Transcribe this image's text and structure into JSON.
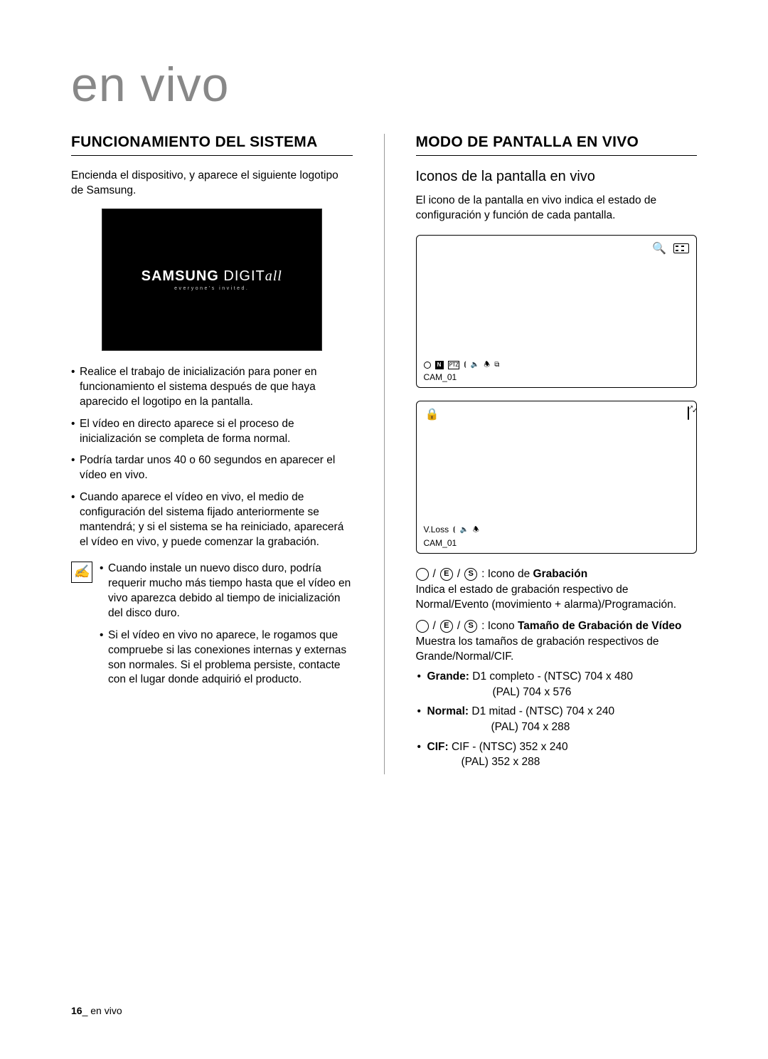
{
  "page_title": "en vivo",
  "left": {
    "heading": "FUNCIONAMIENTO DEL SISTEMA",
    "intro": "Encienda el dispositivo, y aparece el siguiente logotipo de Samsung.",
    "splash_brand_1": "SAMSUNG",
    "splash_brand_2": " DIGIT",
    "splash_brand_3": "all",
    "splash_tagline": "everyone's invited.",
    "bullets": [
      "Realice el trabajo de inicialización para poner en funcionamiento el sistema después de que haya aparecido el logotipo en la pantalla.",
      "El vídeo en directo aparece si el proceso de inicialización se completa de forma normal.",
      "Podría tardar unos 40 o 60 segundos en aparecer el vídeo en vivo.",
      "Cuando aparece el vídeo en vivo, el medio de configuración del sistema fijado anteriormente se mantendrá; y si el sistema se ha reiniciado, aparecerá el vídeo en vivo, y puede comenzar la grabación."
    ],
    "notes": [
      "Cuando instale un nuevo disco duro, podría requerir mucho más tiempo hasta que el vídeo en vivo aparezca debido al tiempo de inicialización del disco duro.",
      "Si el vídeo en vivo no aparece, le rogamos que compruebe si las conexiones internas y externas son normales. Si el problema persiste, contacte con el lugar donde adquirió el producto."
    ]
  },
  "right": {
    "heading": "MODO DE PANTALLA EN VIVO",
    "sub": "Iconos de la pantalla en vivo",
    "desc": "El icono de la pantalla en vivo indica el estado de configuración y función de cada pantalla.",
    "screen1_cam": "CAM_01",
    "screen1_n": "N",
    "screen1_ptz": "PTZ",
    "screen2_vloss": "V.Loss",
    "screen2_cam": "CAM_01",
    "legend": {
      "rec_prefix": " : Icono de ",
      "rec_bold": "Grabación",
      "rec_desc": "Indica el estado de grabación respectivo de Normal/Evento (movimiento + alarma)/Programación.",
      "size_prefix": " : Icono ",
      "size_bold": "Tamaño de Grabación de Vídeo",
      "size_desc": "Muestra los tamaños de grabación respectivos de Grande/Normal/CIF.",
      "grande_label": "Grande:",
      "grande_text": " D1 completo - (NTSC) 704 x 480",
      "grande_pal": "(PAL) 704 x 576",
      "normal_label": "Normal:",
      "normal_text": " D1 mitad - (NTSC) 704 x 240",
      "normal_pal": "(PAL) 704 x 288",
      "cif_label": "CIF:",
      "cif_text": " CIF - (NTSC) 352 x 240",
      "cif_pal": "(PAL) 352 x 288",
      "badge_e": "E",
      "badge_s": "S",
      "slash": "/"
    }
  },
  "footer_page": "16",
  "footer_sep": "_ ",
  "footer_label": "en vivo"
}
